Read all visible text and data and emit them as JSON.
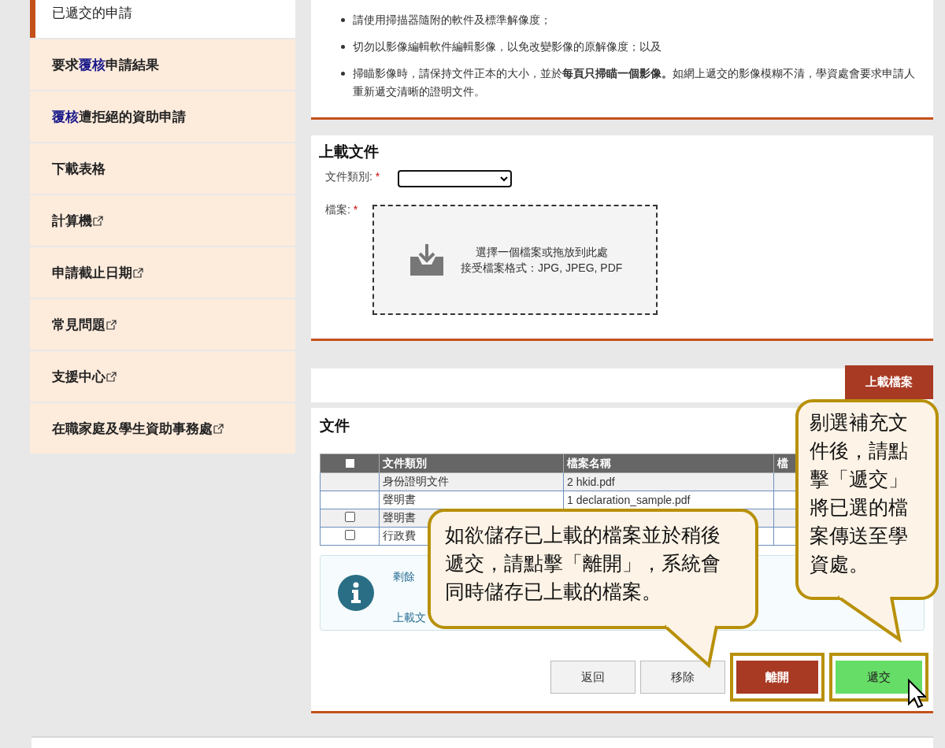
{
  "sidebar": {
    "items": [
      {
        "label": "已遞交的申請",
        "selected": true,
        "external": false
      },
      {
        "label": "要求**覆核**申請結果",
        "selected": false,
        "external": false
      },
      {
        "label": "**覆核**遭拒絕的資助申請",
        "selected": false,
        "external": false
      },
      {
        "label": "下載表格",
        "selected": false,
        "external": false
      },
      {
        "label": "計算機",
        "selected": false,
        "external": true
      },
      {
        "label": "申請截止日期",
        "selected": false,
        "external": true
      },
      {
        "label": "常見問題",
        "selected": false,
        "external": true
      },
      {
        "label": "支援中心",
        "selected": false,
        "external": true
      },
      {
        "label": "在職家庭及學生資助事務處",
        "selected": false,
        "external": true
      }
    ]
  },
  "instructions": {
    "bullets": [
      "請使用掃描器隨附的軟件及標準解像度；",
      "切勿以影像編輯軟件編輯影像，以免改變影像的原解像度；以及",
      "掃瞄影像時，請保持文件正本的大小，並於**每頁只掃瞄一個影像。**如網上遞交的影像模糊不清，學資處會要求申請人重新遞交清晰的證明文件。"
    ]
  },
  "upload": {
    "title": "上載文件",
    "category_label": "文件類別:",
    "category_required": "*",
    "file_label": "檔案:",
    "file_required": "*",
    "dropzone_prompt": "選擇一個檔案或拖放到此處",
    "dropzone_formats": "接受檔案格式：JPG, JPEG, PDF"
  },
  "upload_bar": {
    "button": "上載檔案"
  },
  "documents": {
    "title": "文件",
    "table": {
      "header_checkbox": {
        "checked": false
      },
      "columns": [
        "文件類別",
        "檔案名稱",
        "檔"
      ],
      "rows": [
        {
          "checkbox": null,
          "cells": [
            "身份證明文件",
            "2 hkid.pdf",
            ""
          ]
        },
        {
          "checkbox": null,
          "cells": [
            "聲明書",
            "1 declaration_sample.pdf",
            ""
          ]
        },
        {
          "checkbox": {
            "checked": false
          },
          "cells": [
            "聲明書",
            "",
            ""
          ]
        },
        {
          "checkbox": {
            "checked": false
          },
          "cells": [
            "行政費",
            "",
            ""
          ]
        }
      ]
    },
    "info_lines": [
      "剩餘",
      "上載文"
    ],
    "buttons": [
      {
        "label": "返回",
        "kind": "default",
        "highlighted": false
      },
      {
        "label": "移除",
        "kind": "default",
        "highlighted": false
      },
      {
        "label": "離開",
        "kind": "danger",
        "highlighted": true
      },
      {
        "label": "遞交",
        "kind": "success",
        "highlighted": true
      }
    ]
  },
  "callouts": [
    {
      "text": "如欲儲存已上載的檔案並於稍後遞交，請點擊「離開」，系統會同時儲存已上載的檔案。"
    },
    {
      "text": "剔選補充文件後，請點擊「遞交」將已選的檔案傳送至學資處。"
    }
  ]
}
